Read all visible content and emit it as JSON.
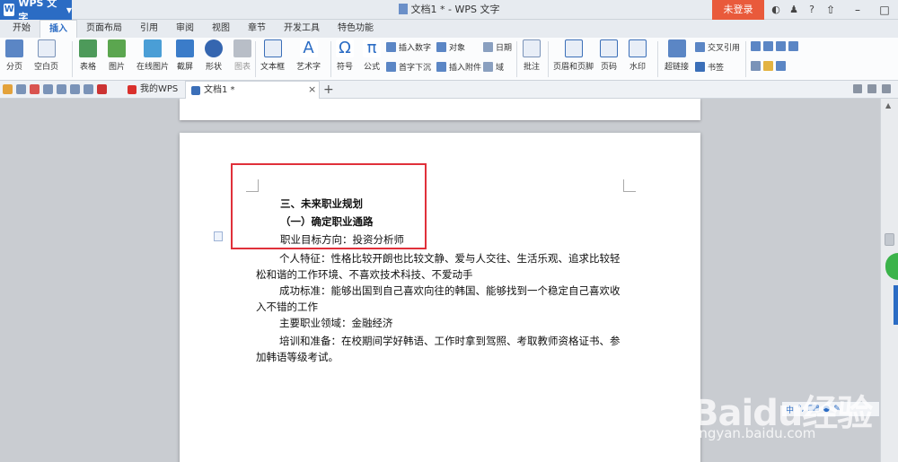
{
  "app": {
    "menu_label": "WPS 文字",
    "window_title": "文档1 * - WPS 文字",
    "login_label": "未登录",
    "help_label": "?"
  },
  "ribbon_tabs": [
    "开始",
    "插入",
    "页面布局",
    "引用",
    "审阅",
    "视图",
    "章节",
    "开发工具",
    "特色功能"
  ],
  "ribbon": {
    "page_break": "分页",
    "blank_page": "空白页",
    "table": "表格",
    "picture": "图片",
    "online_picture": "在线图片",
    "screenshot": "截屏",
    "shape": "形状",
    "chart": "图表",
    "textbox": "文本框",
    "wordart": "艺术字",
    "symbol": "符号",
    "formula": "公式",
    "insert_number": "插入数字",
    "object": "对象",
    "date": "日期",
    "drop_cap": "首字下沉",
    "attachment": "插入附件",
    "field": "域",
    "comment": "批注",
    "header_footer": "页眉和页脚",
    "page_number": "页码",
    "watermark": "水印",
    "hyperlink": "超链接",
    "cross_ref": "交叉引用",
    "bookmark": "书签"
  },
  "doc_tabs": {
    "mywps": "我的WPS",
    "doc1": "文档1 *"
  },
  "document": {
    "heading": "三、未来职业规划",
    "subheading": "（一）确定职业通路",
    "paragraphs": [
      "职业目标方向：投资分析师",
      "个人特征：性格比较开朗也比较文静、爱与人交往、生活乐观、追求比较轻松和谐的工作环境、不喜欢技术科技、不爱动手",
      "成功标准：能够出国到自己喜欢向往的韩国、能够找到一个稳定自己喜欢收入不错的工作",
      "主要职业领域：金融经济",
      "培训和准备：在校期间学好韩语、工作时拿到驾照、考取教师资格证书、参加韩语等级考试。"
    ]
  },
  "watermark": {
    "brand": "Baidu经验",
    "url": "jingyan.baidu.com"
  },
  "colors": {
    "accent": "#2b6cc4",
    "login": "#e95a3b",
    "highlight_box": "#e0303a"
  }
}
